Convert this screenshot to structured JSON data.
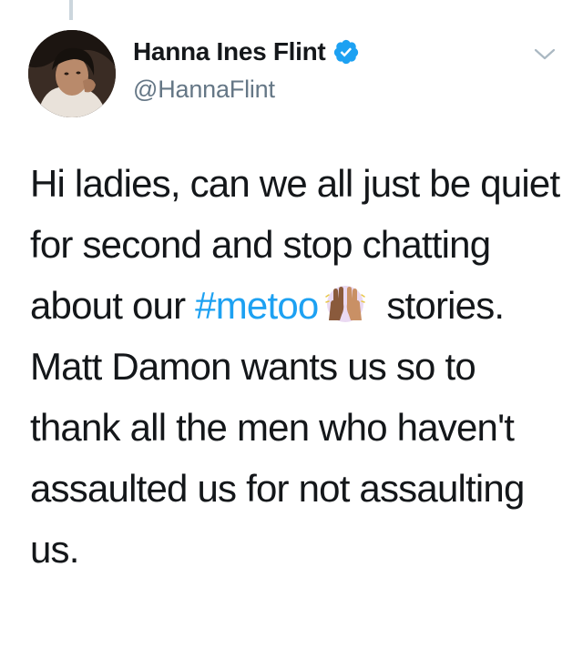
{
  "tweet": {
    "display_name": "Hanna Ines Flint",
    "handle": "@HannaFlint",
    "text_part1": "Hi ladies, can we all just be quiet for second and stop chatting about our ",
    "hashtag": "#metoo",
    "emoji_icon": "raised-hands-emoji",
    "text_part2": " stories. Matt Damon wants us so to thank all the men who haven't assaulted us for not assaulting us.",
    "verified": true
  },
  "colors": {
    "accent": "#1da1f2",
    "text": "#14171a",
    "secondary_text": "#657786",
    "thread_line": "#ccd6dd"
  }
}
